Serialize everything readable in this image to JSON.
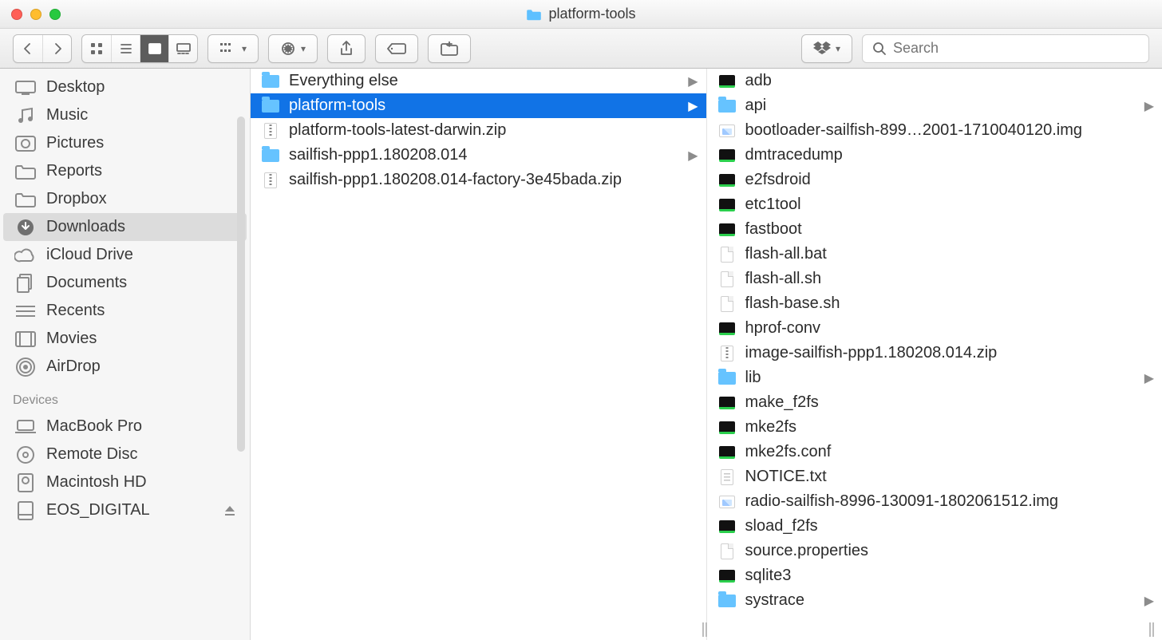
{
  "window": {
    "title": "platform-tools"
  },
  "search": {
    "placeholder": "Search"
  },
  "sidebar": {
    "favorites": [
      {
        "label": "Desktop",
        "icon": "desktop"
      },
      {
        "label": "Music",
        "icon": "music"
      },
      {
        "label": "Pictures",
        "icon": "pictures"
      },
      {
        "label": "Reports",
        "icon": "folder-gray"
      },
      {
        "label": "Dropbox",
        "icon": "folder-gray"
      },
      {
        "label": "Downloads",
        "icon": "downloads",
        "selected": true
      },
      {
        "label": "iCloud Drive",
        "icon": "cloud"
      },
      {
        "label": "Documents",
        "icon": "documents"
      },
      {
        "label": "Recents",
        "icon": "recents"
      },
      {
        "label": "Movies",
        "icon": "movies"
      },
      {
        "label": "AirDrop",
        "icon": "airdrop"
      }
    ],
    "devices_label": "Devices",
    "devices": [
      {
        "label": "MacBook Pro",
        "icon": "laptop"
      },
      {
        "label": "Remote Disc",
        "icon": "disc"
      },
      {
        "label": "Macintosh HD",
        "icon": "hdd"
      },
      {
        "label": "EOS_DIGITAL",
        "icon": "ext",
        "ejectable": true
      }
    ]
  },
  "columns": {
    "middle": [
      {
        "name": "Everything else",
        "type": "folder",
        "expandable": true
      },
      {
        "name": "platform-tools",
        "type": "folder",
        "expandable": true,
        "selected": true
      },
      {
        "name": "platform-tools-latest-darwin.zip",
        "type": "zip"
      },
      {
        "name": "sailfish-ppp1.180208.014",
        "type": "folder",
        "expandable": true
      },
      {
        "name": "sailfish-ppp1.180208.014-factory-3e45bada.zip",
        "type": "zip"
      }
    ],
    "right": [
      {
        "name": "adb",
        "type": "exec"
      },
      {
        "name": "api",
        "type": "folder",
        "expandable": true
      },
      {
        "name": "bootloader-sailfish-899…2001-1710040120.img",
        "type": "img"
      },
      {
        "name": "dmtracedump",
        "type": "exec"
      },
      {
        "name": "e2fsdroid",
        "type": "exec"
      },
      {
        "name": "etc1tool",
        "type": "exec"
      },
      {
        "name": "fastboot",
        "type": "exec"
      },
      {
        "name": "flash-all.bat",
        "type": "doc"
      },
      {
        "name": "flash-all.sh",
        "type": "doc"
      },
      {
        "name": "flash-base.sh",
        "type": "doc"
      },
      {
        "name": "hprof-conv",
        "type": "exec"
      },
      {
        "name": "image-sailfish-ppp1.180208.014.zip",
        "type": "zip"
      },
      {
        "name": "lib",
        "type": "folder",
        "expandable": true
      },
      {
        "name": "make_f2fs",
        "type": "exec"
      },
      {
        "name": "mke2fs",
        "type": "exec"
      },
      {
        "name": "mke2fs.conf",
        "type": "exec"
      },
      {
        "name": "NOTICE.txt",
        "type": "txt"
      },
      {
        "name": "radio-sailfish-8996-130091-1802061512.img",
        "type": "img"
      },
      {
        "name": "sload_f2fs",
        "type": "exec"
      },
      {
        "name": "source.properties",
        "type": "doc"
      },
      {
        "name": "sqlite3",
        "type": "exec"
      },
      {
        "name": "systrace",
        "type": "folder",
        "expandable": true
      }
    ]
  }
}
